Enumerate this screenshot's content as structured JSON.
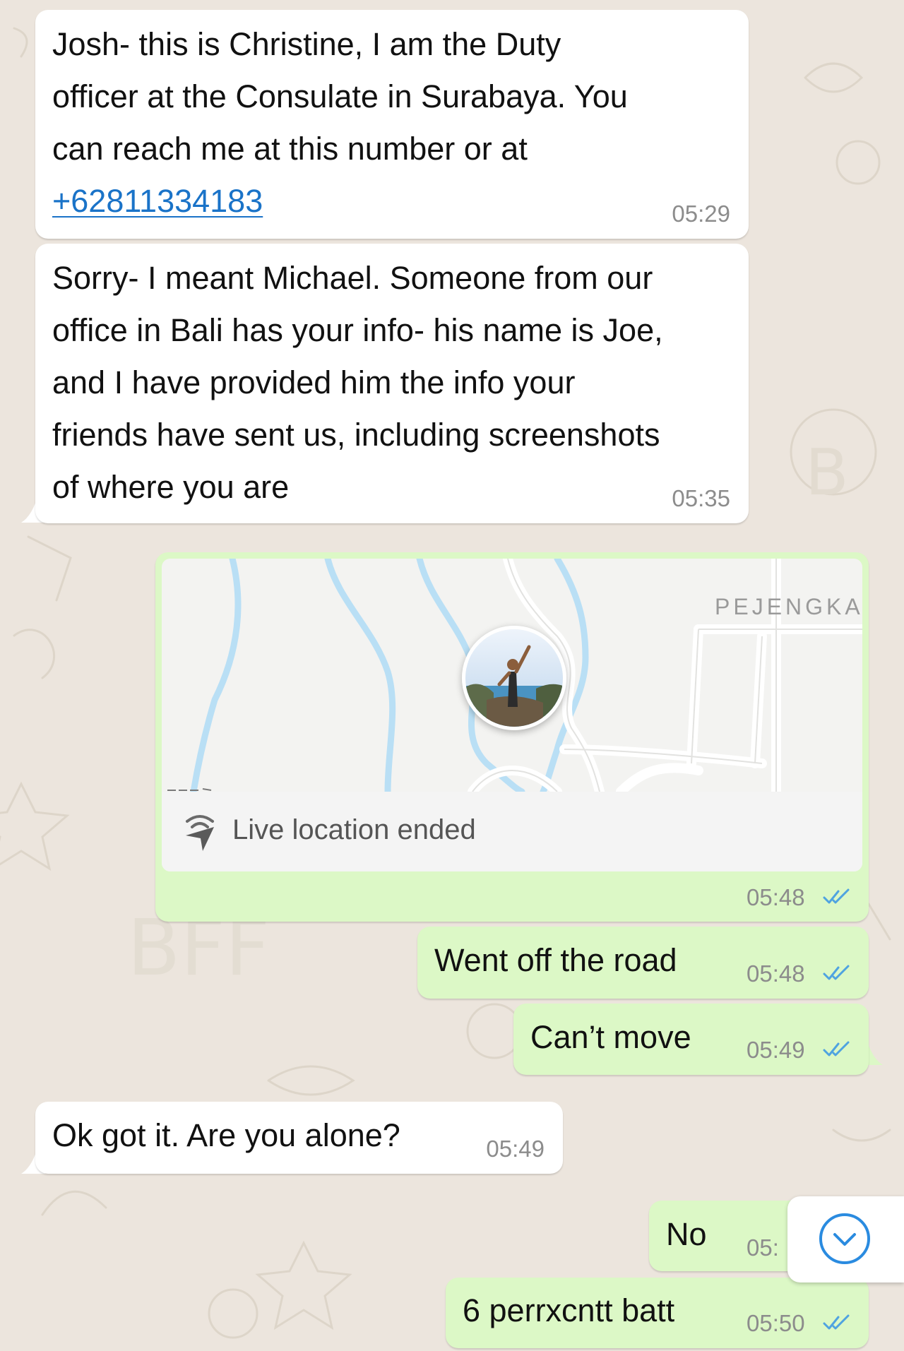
{
  "messages": [
    {
      "direction": "incoming",
      "lines": [
        "Josh- this is Christine, I am the Duty",
        "officer at the Consulate in Surabaya. You",
        "can reach me at this number or at"
      ],
      "phone_link": "+62811334183",
      "time": "05:29"
    },
    {
      "direction": "incoming",
      "lines": [
        "Sorry- I meant Michael. Someone from our",
        "office in Bali has your info- his name is Joe,",
        "and I have provided him the info your",
        "friends have sent us, including screenshots",
        "of where you are"
      ],
      "time": "05:35"
    },
    {
      "direction": "outgoing",
      "type": "live-location",
      "map_place_label": "PEJENGKA",
      "status": "Live location ended",
      "time": "05:48",
      "read": true
    },
    {
      "direction": "outgoing",
      "text": "Went off the road",
      "time": "05:48",
      "read": true
    },
    {
      "direction": "outgoing",
      "text": "Can’t move",
      "time": "05:49",
      "read": true
    },
    {
      "direction": "incoming",
      "text": "Ok got it. Are you alone?",
      "time": "05:49"
    },
    {
      "direction": "outgoing",
      "text": "No",
      "time": "05:",
      "read": true
    },
    {
      "direction": "outgoing",
      "text": "6 perrxcntt batt",
      "time": "05:50",
      "read": true
    }
  ],
  "colors": {
    "background": "#ece5dd",
    "incoming_bubble": "#ffffff",
    "outgoing_bubble": "#dcf8c6",
    "read_ticks": "#4fa3e0",
    "link": "#1a73c8",
    "map_water": "#b9dff5"
  },
  "icons": {
    "read_receipt": "double-check-icon",
    "live_location": "live-location-icon",
    "scroll_down": "chevron-down-icon"
  }
}
